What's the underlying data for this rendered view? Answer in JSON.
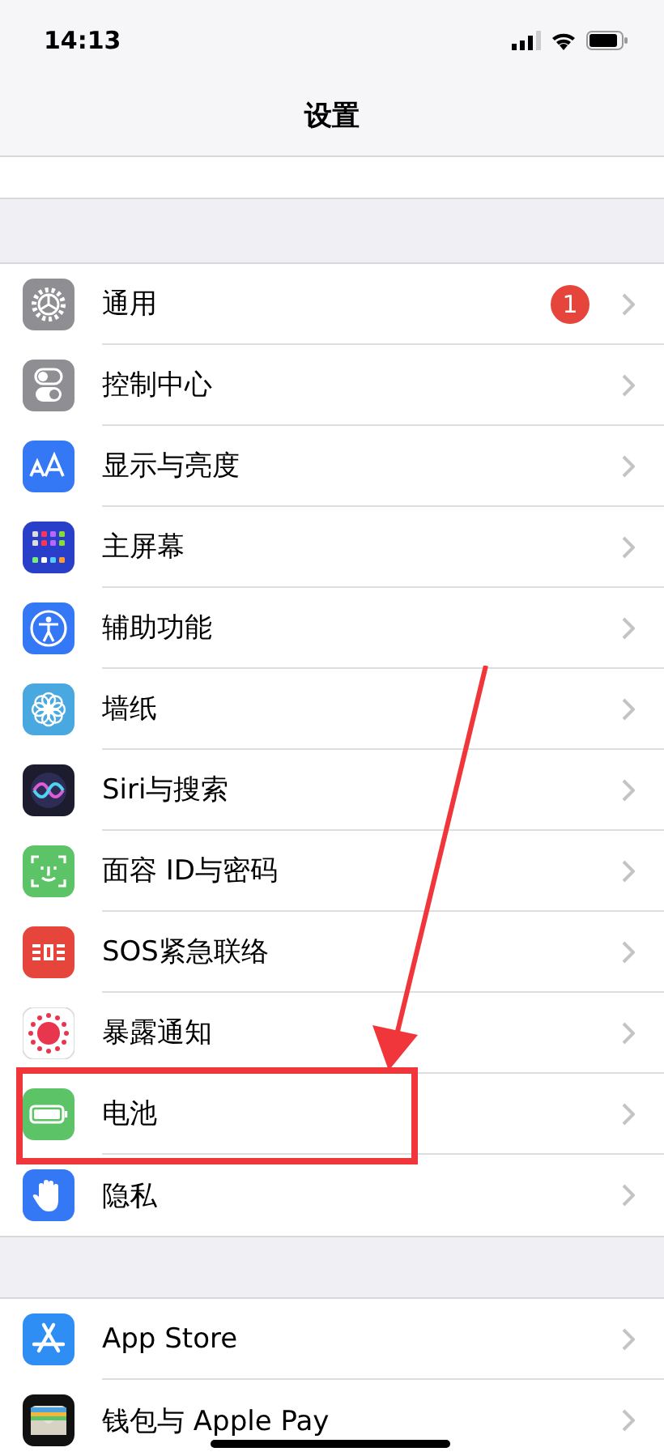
{
  "status_bar": {
    "time": "14:13"
  },
  "nav": {
    "title": "设置"
  },
  "groups": [
    {
      "rows": [
        {
          "label": "通用",
          "kind": "gear",
          "badge": "1",
          "highlighted": false
        },
        {
          "label": "控制中心",
          "kind": "toggles",
          "highlighted": false
        },
        {
          "label": "显示与亮度",
          "kind": "text-size",
          "highlighted": false
        },
        {
          "label": "主屏幕",
          "kind": "grid",
          "highlighted": false
        },
        {
          "label": "辅助功能",
          "kind": "accessibility",
          "highlighted": false
        },
        {
          "label": "墙纸",
          "kind": "flower",
          "highlighted": false
        },
        {
          "label": "Siri与搜索",
          "kind": "siri",
          "highlighted": false
        },
        {
          "label": "面容 ID与密码",
          "kind": "face",
          "highlighted": false
        },
        {
          "label": "SOS紧急联络",
          "kind": "sos",
          "highlighted": false
        },
        {
          "label": "暴露通知",
          "kind": "exposure",
          "highlighted": false
        },
        {
          "label": "电池",
          "kind": "battery",
          "highlighted": true
        },
        {
          "label": "隐私",
          "kind": "hand",
          "highlighted": false
        }
      ]
    },
    {
      "rows": [
        {
          "label": "App Store",
          "kind": "appstore",
          "highlighted": false
        },
        {
          "label": "钱包与 Apple Pay",
          "kind": "wallet",
          "highlighted": false
        }
      ]
    }
  ]
}
